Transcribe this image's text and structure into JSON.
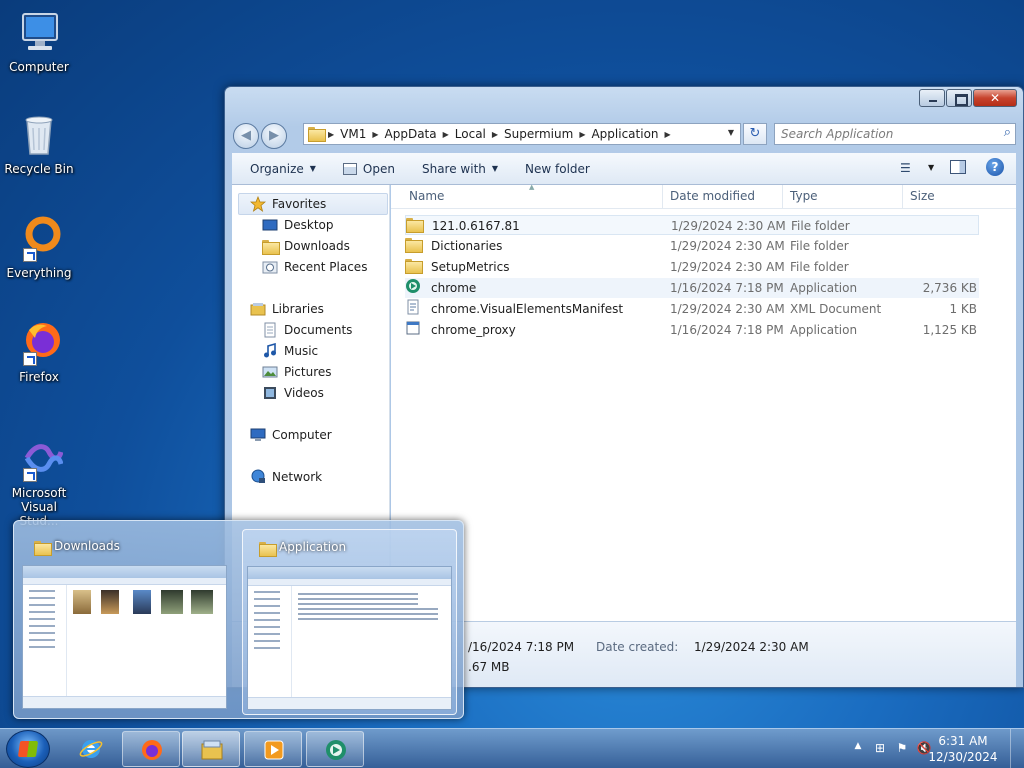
{
  "desktop": {
    "icons": [
      {
        "label": "Computer",
        "icon": "computer-icon"
      },
      {
        "label": "Recycle Bin",
        "icon": "recycle-bin-icon"
      },
      {
        "label": "Everything",
        "icon": "everything-search-icon"
      },
      {
        "label": "Firefox",
        "icon": "firefox-icon"
      },
      {
        "label": "Microsoft Visual Stud...",
        "icon": "visual-studio-icon"
      }
    ]
  },
  "window": {
    "address": [
      "VM1",
      "AppData",
      "Local",
      "Supermium",
      "Application"
    ],
    "search_placeholder": "Search Application",
    "toolbar": {
      "organize": "Organize",
      "open": "Open",
      "share_with": "Share with",
      "new_folder": "New folder"
    },
    "nav": {
      "favorites": "Favorites",
      "desktop": "Desktop",
      "downloads": "Downloads",
      "recent_places": "Recent Places",
      "libraries": "Libraries",
      "documents": "Documents",
      "music": "Music",
      "pictures": "Pictures",
      "videos": "Videos",
      "computer": "Computer",
      "network": "Network"
    },
    "columns": {
      "name": "Name",
      "date": "Date modified",
      "type": "Type",
      "size": "Size"
    },
    "files": [
      {
        "name": "121.0.6167.81",
        "date": "1/29/2024 2:30 AM",
        "type": "File folder",
        "size": "",
        "icon": "folder-icon"
      },
      {
        "name": "Dictionaries",
        "date": "1/29/2024 2:30 AM",
        "type": "File folder",
        "size": "",
        "icon": "folder-icon"
      },
      {
        "name": "SetupMetrics",
        "date": "1/29/2024 2:30 AM",
        "type": "File folder",
        "size": "",
        "icon": "folder-icon"
      },
      {
        "name": "chrome",
        "date": "1/16/2024 7:18 PM",
        "type": "Application",
        "size": "2,736 KB",
        "icon": "supermium-app-icon"
      },
      {
        "name": "chrome.VisualElementsManifest",
        "date": "1/29/2024 2:30 AM",
        "type": "XML Document",
        "size": "1 KB",
        "icon": "xml-file-icon"
      },
      {
        "name": "chrome_proxy",
        "date": "1/16/2024 7:18 PM",
        "type": "Application",
        "size": "1,125 KB",
        "icon": "app-window-icon"
      }
    ],
    "details": {
      "modified_partial": "/16/2024 7:18 PM",
      "size_partial": ".67 MB",
      "created_label": "Date created:",
      "created_value": "1/29/2024 2:30 AM"
    }
  },
  "thumbnails": [
    {
      "title": "Downloads",
      "active": false
    },
    {
      "title": "Application",
      "active": true
    }
  ],
  "taskbar": {
    "pinned": [
      "internet-explorer-icon",
      "firefox-icon",
      "windows-explorer-icon",
      "media-player-icon",
      "supermium-icon"
    ],
    "time": "6:31 AM",
    "date": "12/30/2024"
  },
  "colors": {
    "accent": "#1a6cc0",
    "selection": "#eef4fb"
  }
}
